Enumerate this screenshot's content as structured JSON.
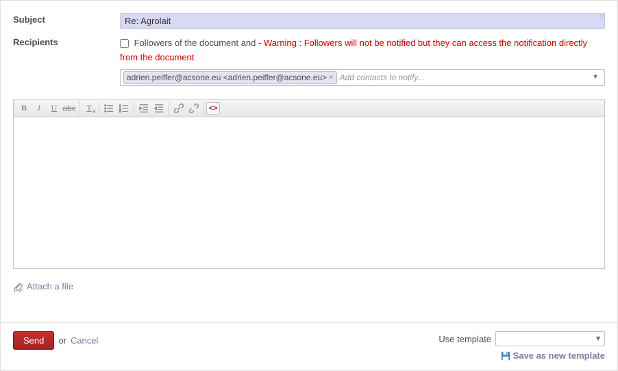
{
  "header": {
    "subject_label": "Subject",
    "subject_value": "Re: Agrolait",
    "recipients_label": "Recipients",
    "followers_text": "Followers of the document and -",
    "warning_text": "Warning : Followers will not be notified but they can access the notification directly from the document",
    "contact_tag": "adrien.peiffer@acsone.eu <adrien.peiffer@acsone.eu>",
    "contacts_placeholder": "Add contacts to notify..."
  },
  "editor": {
    "body": ""
  },
  "attach": {
    "label": "Attach a file"
  },
  "footer": {
    "send_label": "Send",
    "or_label": "or",
    "cancel_label": "Cancel",
    "use_template_label": "Use template",
    "template_value": "",
    "save_template_label": "Save as new template"
  }
}
